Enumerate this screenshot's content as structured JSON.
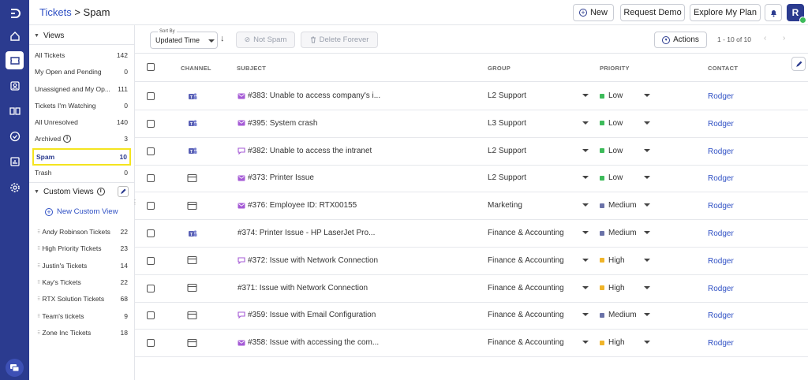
{
  "colors": {
    "accent": "#2b3b8f",
    "link": "#2f50c4",
    "highlight": "#f4e41f",
    "low": "#3dbb5a",
    "medium": "#6a72a8",
    "high": "#f0b429",
    "ticket_icon": "#a55bd6"
  },
  "header": {
    "breadcrumb_parent": "Tickets",
    "breadcrumb_sep": ">",
    "breadcrumb_current": "Spam",
    "new_label": "New",
    "request_demo_label": "Request Demo",
    "explore_plan_label": "Explore My Plan",
    "avatar_initial": "R"
  },
  "sidebar": {
    "views_title": "Views",
    "views": [
      {
        "label": "All Tickets",
        "count": "142"
      },
      {
        "label": "My Open and Pending",
        "count": "0"
      },
      {
        "label": "Unassigned and My Op...",
        "count": "111"
      },
      {
        "label": "Tickets I'm Watching",
        "count": "0"
      },
      {
        "label": "All Unresolved",
        "count": "140"
      },
      {
        "label": "Archived",
        "count": "3"
      },
      {
        "label": "Spam",
        "count": "10"
      },
      {
        "label": "Trash",
        "count": "0"
      }
    ],
    "custom_title": "Custom Views",
    "new_custom_view": "New Custom View",
    "custom_views": [
      {
        "label": "Andy Robinson Tickets",
        "count": "22"
      },
      {
        "label": "High Priority Tickets",
        "count": "23"
      },
      {
        "label": "Justin's Tickets",
        "count": "14"
      },
      {
        "label": "Kay's Tickets",
        "count": "22"
      },
      {
        "label": "RTX Solution Tickets",
        "count": "68"
      },
      {
        "label": "Team's tickets",
        "count": "9"
      },
      {
        "label": "Zone Inc Tickets",
        "count": "18"
      }
    ]
  },
  "toolbar": {
    "sort_by_label": "Sort By",
    "sort_value": "Updated Time",
    "not_spam_label": "Not Spam",
    "delete_forever_label": "Delete Forever",
    "actions_label": "Actions",
    "pagination": "1 - 10 of 10"
  },
  "table": {
    "columns": {
      "channel": "CHANNEL",
      "subject": "SUBJECT",
      "group": "GROUP",
      "priority": "PRIORITY",
      "contact": "CONTACT"
    },
    "rows": [
      {
        "channel": "teams",
        "ticket_icon": "email",
        "subject": "#383: Unable to access company's i...",
        "group": "L2 Support",
        "priority": "Low",
        "contact": "Rodger"
      },
      {
        "channel": "teams",
        "ticket_icon": "email",
        "subject": "#395: System crash",
        "group": "L3 Support",
        "priority": "Low",
        "contact": "Rodger"
      },
      {
        "channel": "teams",
        "ticket_icon": "chat",
        "subject": "#382: Unable to access the intranet",
        "group": "L2 Support",
        "priority": "Low",
        "contact": "Rodger"
      },
      {
        "channel": "portal",
        "ticket_icon": "email",
        "subject": "#373: Printer Issue",
        "group": "L2 Support",
        "priority": "Low",
        "contact": "Rodger"
      },
      {
        "channel": "portal",
        "ticket_icon": "email",
        "subject": "#376: Employee ID: RTX00155",
        "group": "Marketing",
        "priority": "Medium",
        "contact": "Rodger"
      },
      {
        "channel": "teams",
        "ticket_icon": "",
        "subject": "#374: Printer Issue - HP LaserJet Pro...",
        "group": "Finance & Accounting",
        "priority": "Medium",
        "contact": "Rodger"
      },
      {
        "channel": "portal",
        "ticket_icon": "chat",
        "subject": "#372: Issue with Network Connection",
        "group": "Finance & Accounting",
        "priority": "High",
        "contact": "Rodger"
      },
      {
        "channel": "portal",
        "ticket_icon": "",
        "subject": "#371: Issue with Network Connection",
        "group": "Finance & Accounting",
        "priority": "High",
        "contact": "Rodger"
      },
      {
        "channel": "portal",
        "ticket_icon": "chat",
        "subject": "#359: Issue with Email Configuration",
        "group": "Finance & Accounting",
        "priority": "Medium",
        "contact": "Rodger"
      },
      {
        "channel": "portal",
        "ticket_icon": "email",
        "subject": "#358: Issue with accessing the com...",
        "group": "Finance & Accounting",
        "priority": "High",
        "contact": "Rodger"
      }
    ]
  }
}
